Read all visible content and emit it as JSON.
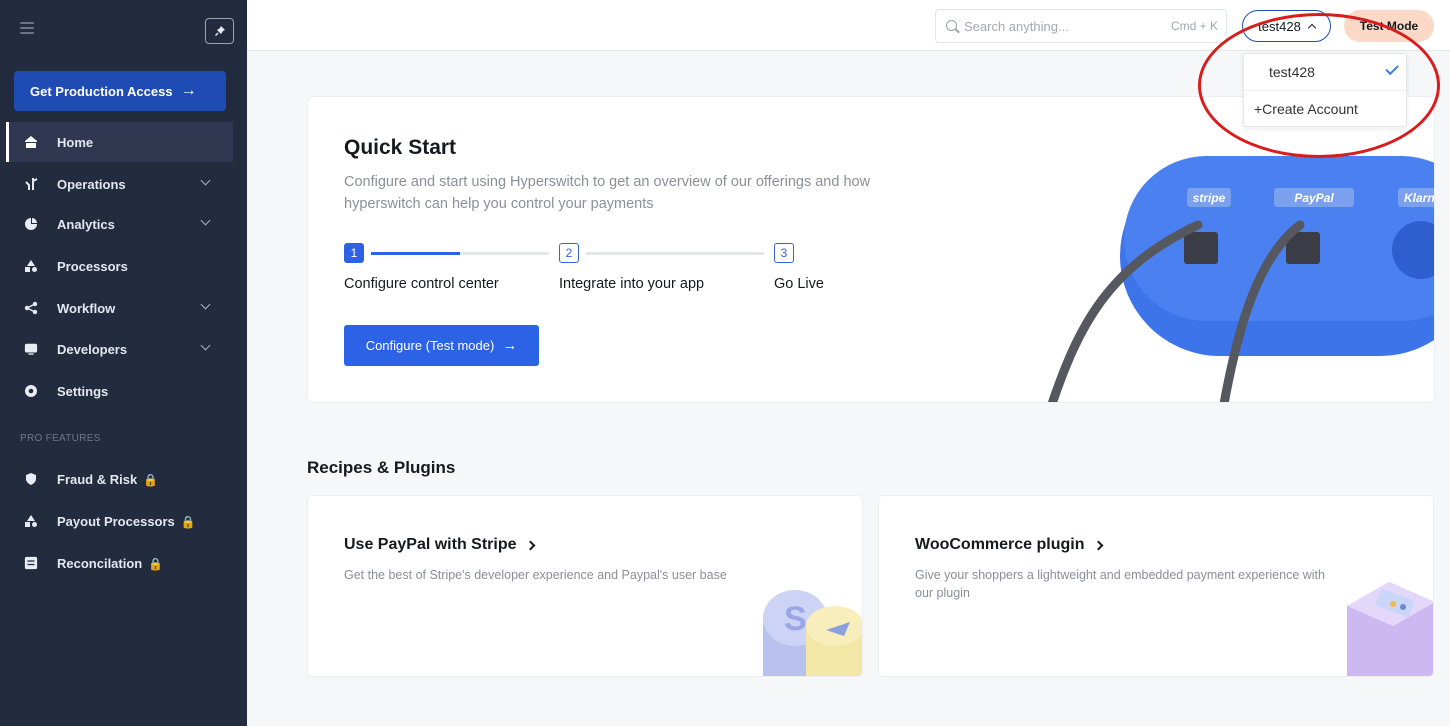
{
  "sidebar": {
    "cta_label": "Get Production Access",
    "cta_arrow": "→",
    "items": [
      {
        "label": "Home",
        "icon": "home-icon"
      },
      {
        "label": "Operations",
        "icon": "operations-icon"
      },
      {
        "label": "Analytics",
        "icon": "analytics-icon"
      },
      {
        "label": "Processors",
        "icon": "processors-icon"
      },
      {
        "label": "Workflow",
        "icon": "workflow-icon"
      },
      {
        "label": "Developers",
        "icon": "developers-icon"
      },
      {
        "label": "Settings",
        "icon": "settings-icon"
      }
    ],
    "pro_section_label": "PRO FEATURES",
    "pro_items": [
      {
        "label": "Fraud & Risk",
        "icon": "fraud-icon"
      },
      {
        "label": "Payout Processors",
        "icon": "payout-icon"
      },
      {
        "label": "Reconcilation",
        "icon": "reconciliation-icon"
      }
    ]
  },
  "header": {
    "search_placeholder": "Search anything...",
    "search_shortcut": "Cmd + K",
    "account_name": "test428",
    "mode_label": "Test Mode"
  },
  "account_dropdown": {
    "selected": "test428",
    "create_label": "+Create Account"
  },
  "quick_start": {
    "title": "Quick Start",
    "description": "Configure and start using Hyperswitch to get an overview of our offerings and how hyperswitch can help you control your payments",
    "steps": [
      {
        "number": "1",
        "label": "Configure control center"
      },
      {
        "number": "2",
        "label": "Integrate into your app"
      },
      {
        "number": "3",
        "label": "Go Live"
      }
    ],
    "progress": 0.5,
    "cta_label": "Configure (Test mode)",
    "cta_arrow": "→",
    "brands": [
      "stripe",
      "PayPal",
      "Klarna"
    ]
  },
  "recipes": {
    "title": "Recipes & Plugins",
    "cards": [
      {
        "title": "Use PayPal with Stripe",
        "description": "Get the best of Stripe's developer experience and Paypal's user base"
      },
      {
        "title": "WooCommerce plugin",
        "description": "Give your shoppers a lightweight and embedded payment experience with our plugin"
      }
    ]
  },
  "colors": {
    "sidebar_bg": "#232b3f",
    "primary": "#2c63e6",
    "test_mode_bg": "#fbd9c6",
    "annotation": "#d91c1c"
  }
}
